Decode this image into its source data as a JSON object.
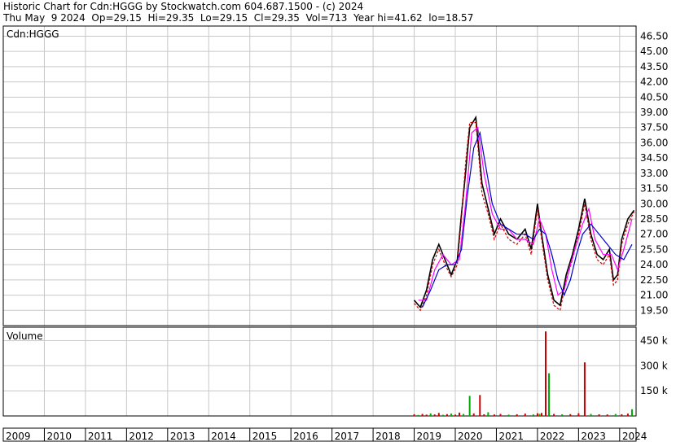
{
  "header": {
    "title": "Historic Chart for Cdn:HGGG by Stockwatch.com 604.687.1500 - (c) 2024",
    "quote": "Thu May  9 2024  Op=29.15  Hi=29.35  Lo=29.15  Cl=29.35  Vol=713  Year hi=41.62  lo=18.57"
  },
  "chart_data": [
    {
      "type": "line",
      "title": "Cdn:HGGG",
      "ylim": [
        18.0,
        47.5
      ],
      "yticks": [
        "46.50",
        "45.00",
        "43.50",
        "42.00",
        "40.50",
        "39.00",
        "37.50",
        "36.00",
        "34.50",
        "33.00",
        "31.50",
        "30.00",
        "28.50",
        "27.00",
        "25.50",
        "24.00",
        "22.50",
        "21.00",
        "19.50"
      ],
      "grid": true,
      "series": [
        {
          "color": "#000000",
          "style": "solid",
          "x": [
            2019.0,
            2019.15,
            2019.3,
            2019.45,
            2019.6,
            2019.75,
            2019.9,
            2020.05,
            2020.15,
            2020.25,
            2020.35,
            2020.5,
            2020.65,
            2020.8,
            2020.95,
            2021.1,
            2021.3,
            2021.5,
            2021.7,
            2021.85,
            2022.0,
            2022.1,
            2022.25,
            2022.4,
            2022.55,
            2022.7,
            2022.85,
            2023.0,
            2023.15,
            2023.3,
            2023.45,
            2023.6,
            2023.75,
            2023.85,
            2023.95,
            2024.05,
            2024.2,
            2024.35
          ],
          "values": [
            20.5,
            19.8,
            21.5,
            24.5,
            26.0,
            24.5,
            23.0,
            24.5,
            29.0,
            33.0,
            37.5,
            38.5,
            32.0,
            29.5,
            27.0,
            28.5,
            27.0,
            26.5,
            27.5,
            25.5,
            30.0,
            27.0,
            23.0,
            20.5,
            20.0,
            23.0,
            25.0,
            27.5,
            30.5,
            27.0,
            25.0,
            24.5,
            25.5,
            22.5,
            23.0,
            26.5,
            28.5,
            29.35
          ]
        },
        {
          "color": "#cc0000",
          "style": "dashed",
          "x": [
            2019.0,
            2019.15,
            2019.3,
            2019.45,
            2019.6,
            2019.75,
            2019.9,
            2020.05,
            2020.15,
            2020.25,
            2020.35,
            2020.5,
            2020.65,
            2020.8,
            2020.95,
            2021.1,
            2021.3,
            2021.5,
            2021.7,
            2021.85,
            2022.0,
            2022.1,
            2022.25,
            2022.4,
            2022.55,
            2022.7,
            2022.85,
            2023.0,
            2023.15,
            2023.3,
            2023.45,
            2023.6,
            2023.75,
            2023.85,
            2023.95,
            2024.05,
            2024.2,
            2024.35
          ],
          "values": [
            20.2,
            19.5,
            21.0,
            24.0,
            25.5,
            24.0,
            22.8,
            24.0,
            28.5,
            34.0,
            38.0,
            38.0,
            31.0,
            29.0,
            26.5,
            28.0,
            26.5,
            26.0,
            27.0,
            25.0,
            29.5,
            26.5,
            22.5,
            20.0,
            19.5,
            22.5,
            24.5,
            27.0,
            30.0,
            26.5,
            24.5,
            24.0,
            25.0,
            22.0,
            22.5,
            26.0,
            28.0,
            29.2
          ]
        },
        {
          "color": "#ff00ff",
          "style": "solid",
          "x": [
            2019.1,
            2019.3,
            2019.5,
            2019.7,
            2019.9,
            2020.1,
            2020.25,
            2020.4,
            2020.55,
            2020.7,
            2020.9,
            2021.1,
            2021.3,
            2021.5,
            2021.7,
            2021.9,
            2022.05,
            2022.2,
            2022.35,
            2022.5,
            2022.65,
            2022.8,
            2022.95,
            2023.1,
            2023.25,
            2023.4,
            2023.6,
            2023.8,
            2023.95,
            2024.1,
            2024.3
          ],
          "values": [
            20.5,
            20.5,
            23.5,
            25.0,
            24.0,
            24.5,
            30.0,
            37.0,
            37.5,
            33.0,
            29.0,
            27.5,
            27.5,
            26.5,
            26.5,
            26.0,
            28.5,
            27.0,
            23.5,
            21.0,
            21.5,
            24.0,
            26.0,
            28.0,
            29.5,
            26.5,
            25.0,
            25.0,
            23.5,
            25.5,
            28.5
          ]
        },
        {
          "color": "#0000cc",
          "style": "solid",
          "x": [
            2019.2,
            2019.4,
            2019.6,
            2019.8,
            2020.0,
            2020.15,
            2020.3,
            2020.45,
            2020.6,
            2020.75,
            2020.9,
            2021.1,
            2021.3,
            2021.5,
            2021.7,
            2021.9,
            2022.05,
            2022.2,
            2022.35,
            2022.5,
            2022.65,
            2022.8,
            2022.95,
            2023.1,
            2023.3,
            2023.5,
            2023.7,
            2023.9,
            2024.1,
            2024.3
          ],
          "values": [
            19.8,
            21.5,
            23.5,
            24.0,
            24.0,
            25.5,
            31.0,
            35.5,
            37.0,
            33.5,
            30.0,
            28.0,
            27.5,
            27.0,
            27.0,
            26.5,
            27.5,
            27.0,
            25.0,
            22.5,
            21.0,
            22.5,
            25.0,
            27.0,
            28.0,
            27.0,
            26.0,
            25.0,
            24.5,
            26.0
          ]
        }
      ]
    },
    {
      "type": "bar",
      "title": "Volume",
      "yticks": [
        "450 k",
        "300 k",
        "150 k"
      ],
      "ylim": [
        0,
        530
      ],
      "grid": true,
      "bars": [
        {
          "x": 2019.0,
          "value": 10,
          "color": "#cc0000"
        },
        {
          "x": 2019.1,
          "value": 6,
          "color": "#00aa00"
        },
        {
          "x": 2019.2,
          "value": 12,
          "color": "#cc0000"
        },
        {
          "x": 2019.3,
          "value": 8,
          "color": "#cc0000"
        },
        {
          "x": 2019.4,
          "value": 15,
          "color": "#00aa00"
        },
        {
          "x": 2019.5,
          "value": 9,
          "color": "#cc0000"
        },
        {
          "x": 2019.6,
          "value": 18,
          "color": "#cc0000"
        },
        {
          "x": 2019.7,
          "value": 7,
          "color": "#00aa00"
        },
        {
          "x": 2019.8,
          "value": 11,
          "color": "#cc0000"
        },
        {
          "x": 2019.9,
          "value": 14,
          "color": "#00aa00"
        },
        {
          "x": 2020.0,
          "value": 8,
          "color": "#cc0000"
        },
        {
          "x": 2020.1,
          "value": 20,
          "color": "#cc0000"
        },
        {
          "x": 2020.2,
          "value": 12,
          "color": "#00aa00"
        },
        {
          "x": 2020.35,
          "value": 120,
          "color": "#00aa00"
        },
        {
          "x": 2020.45,
          "value": 15,
          "color": "#cc0000"
        },
        {
          "x": 2020.6,
          "value": 125,
          "color": "#cc0000"
        },
        {
          "x": 2020.7,
          "value": 10,
          "color": "#cc0000"
        },
        {
          "x": 2020.8,
          "value": 22,
          "color": "#00aa00"
        },
        {
          "x": 2020.95,
          "value": 9,
          "color": "#cc0000"
        },
        {
          "x": 2021.1,
          "value": 12,
          "color": "#cc0000"
        },
        {
          "x": 2021.3,
          "value": 8,
          "color": "#00aa00"
        },
        {
          "x": 2021.5,
          "value": 10,
          "color": "#cc0000"
        },
        {
          "x": 2021.7,
          "value": 14,
          "color": "#cc0000"
        },
        {
          "x": 2021.9,
          "value": 9,
          "color": "#00aa00"
        },
        {
          "x": 2022.0,
          "value": 16,
          "color": "#cc0000"
        },
        {
          "x": 2022.05,
          "value": 12,
          "color": "#00aa00"
        },
        {
          "x": 2022.1,
          "value": 18,
          "color": "#cc0000"
        },
        {
          "x": 2022.2,
          "value": 505,
          "color": "#cc0000"
        },
        {
          "x": 2022.28,
          "value": 255,
          "color": "#00aa00"
        },
        {
          "x": 2022.4,
          "value": 12,
          "color": "#cc0000"
        },
        {
          "x": 2022.6,
          "value": 10,
          "color": "#00aa00"
        },
        {
          "x": 2022.8,
          "value": 11,
          "color": "#cc0000"
        },
        {
          "x": 2023.0,
          "value": 16,
          "color": "#cc0000"
        },
        {
          "x": 2023.15,
          "value": 320,
          "color": "#cc0000"
        },
        {
          "x": 2023.3,
          "value": 12,
          "color": "#00aa00"
        },
        {
          "x": 2023.5,
          "value": 10,
          "color": "#cc0000"
        },
        {
          "x": 2023.7,
          "value": 9,
          "color": "#cc0000"
        },
        {
          "x": 2023.9,
          "value": 12,
          "color": "#00aa00"
        },
        {
          "x": 2024.05,
          "value": 10,
          "color": "#cc0000"
        },
        {
          "x": 2024.2,
          "value": 14,
          "color": "#cc0000"
        },
        {
          "x": 2024.3,
          "value": 40,
          "color": "#00aa00"
        }
      ]
    }
  ],
  "x_axis": {
    "years": [
      "2009",
      "2010",
      "2011",
      "2012",
      "2013",
      "2014",
      "2015",
      "2016",
      "2017",
      "2018",
      "2019",
      "2020",
      "2021",
      "2022",
      "2023",
      "2024"
    ],
    "xlim": [
      2009.0,
      2024.4
    ]
  }
}
